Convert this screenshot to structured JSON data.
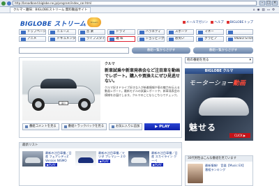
{
  "browser": {
    "address": "http://broadband.biglobe.ne.jp/program/index_car.html",
    "tab_title": "クルマ・趣味：BIGLOBEストリーム 無料動画サイト",
    "toolbar_icons": [
      "home-icon",
      "feed-icon",
      "print-icon",
      "page-icon",
      "tools-icon"
    ]
  },
  "header": {
    "logo_text": "BIGLOBE",
    "logo_suffix": "ストリーム",
    "badge": "Stream",
    "links": [
      "メールマガジン",
      "ヘルプ",
      "BIGLOBEトップ"
    ]
  },
  "categories": [
    {
      "label": "トップページ",
      "selected": false
    },
    {
      "label": "ニュース",
      "selected": false
    },
    {
      "label": "音 楽",
      "selected": false
    },
    {
      "label": "ドラマ",
      "selected": false
    },
    {
      "label": "バラエティ",
      "selected": false
    },
    {
      "label": "スポーツ",
      "selected": false
    },
    {
      "label": "マネー",
      "selected": false
    },
    {
      "label": "",
      "selected": false
    },
    {
      "label": "アニメ",
      "selected": false
    },
    {
      "label": "ドキュメンタリー",
      "selected": false
    },
    {
      "label": "ライフスタイル",
      "selected": false
    },
    {
      "label": "趣 味",
      "selected": true
    },
    {
      "label": "ショッピング",
      "selected": false
    },
    {
      "label": "お笑い",
      "selected": false
    },
    {
      "label": "グラビア",
      "selected": false
    },
    {
      "label": "VIDEO STORE",
      "selected": false
    }
  ],
  "search": {
    "button_1": "番組一覧からさがす",
    "button_2": "番組一覧からさがす"
  },
  "main": {
    "section": "クルマ",
    "lead": "新車試乗や新車発表会など注目車を動画でレポート。購入や買換えにぜひ見逃せない。",
    "description": "クルマ好きドライブ好きな人が新着情報や車の魅力を伝える動画レポート。最新モデルの試乗レポートや、新車発表会の模様をお届けします。クルマのことならこちらでチェック。",
    "plate": "品川",
    "actions": [
      "番組コメントを見る",
      "番組トラックバックを見る",
      "お気に入りに追加"
    ],
    "play": "▶ PLAY"
  },
  "right": {
    "dropdown": "他の番組を見る",
    "promo_header": "BIGLOBE クルマ",
    "promo_tag": "モーターショー",
    "promo_tag_accent": "動画",
    "promo_big": "魅せる",
    "promo_click": "CLICK ▶"
  },
  "list": {
    "header": "最新リスト",
    "items": [
      {
        "text": "最新の注目車種／日産 フェアレディZ Version NISMO",
        "play": "▶PLAY"
      },
      {
        "text": "最新の注目車種／マツダ プレマシー 2.0",
        "play": "▶PLAY"
      },
      {
        "text": "最新の注目車種／日産 スカイライン クーペ",
        "play": "▶PLAY"
      }
    ]
  },
  "side": {
    "header": "30代男性はこんな番組を見ています",
    "item_text": "最新情報！ 音楽【Music EX】",
    "item_sub": "番組ランキング"
  }
}
